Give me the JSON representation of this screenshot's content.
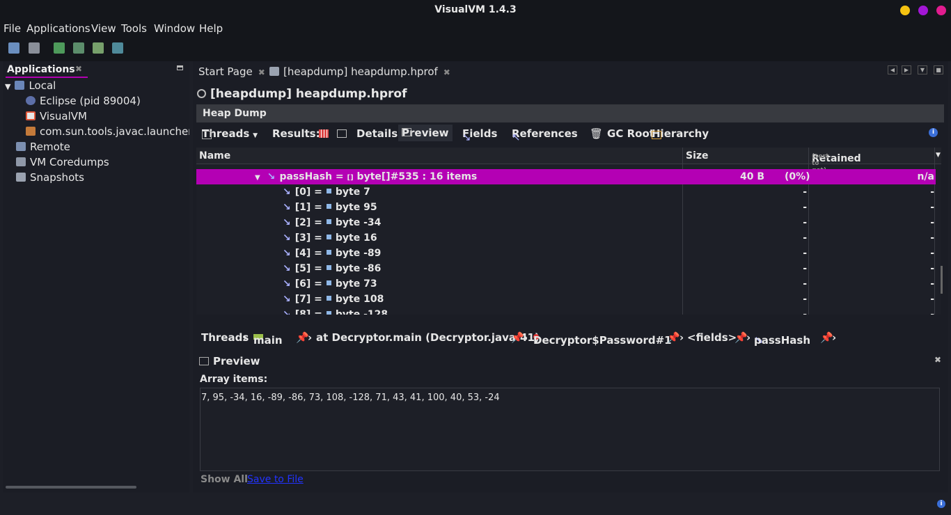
{
  "window": {
    "title": "VisualVM 1.4.3",
    "colors": {
      "yellow": "#f5c211",
      "purple": "#a316d6",
      "pink": "#e11c8f"
    }
  },
  "menu": [
    "File",
    "Applications",
    "View",
    "Tools",
    "Window",
    "Help"
  ],
  "left_panel": {
    "tab": "Applications",
    "tree": [
      {
        "label": "Local",
        "icon": "local-host-icon",
        "expanded": true
      },
      {
        "label": "Eclipse (pid 89004)",
        "icon": "eclipse-icon"
      },
      {
        "label": "VisualVM",
        "icon": "visualvm-icon"
      },
      {
        "label": "com.sun.tools.javac.launcher.M",
        "icon": "java-icon"
      },
      {
        "label": "Remote",
        "icon": "remote-icon"
      },
      {
        "label": "VM Coredumps",
        "icon": "coredump-icon"
      },
      {
        "label": "Snapshots",
        "icon": "snapshot-icon"
      }
    ]
  },
  "tabs": [
    {
      "label": "Start Page"
    },
    {
      "label": "[heapdump] heapdump.hprof"
    }
  ],
  "document": {
    "title": "[heapdump] heapdump.hprof",
    "section": "Heap Dump",
    "subbar": {
      "threads": "Threads",
      "results": "Results:",
      "details": "Details:",
      "preview": "Preview",
      "fields": "Fields",
      "references": "References",
      "gc_root": "GC Root",
      "hierarchy": "Hierarchy"
    },
    "table": {
      "columns": {
        "name": "Name",
        "size": "Size",
        "retained": "Retained",
        "retained_hint": "(sort to get)"
      },
      "rows": [
        {
          "name": "passHash",
          "value": "byte[]#535 : 16 items",
          "size": "40 B",
          "pct": "(0%)",
          "retained": "n/a",
          "selected": true
        },
        {
          "name": "[0]",
          "value": "byte 7",
          "size": "-",
          "retained": "-"
        },
        {
          "name": "[1]",
          "value": "byte 95",
          "size": "-",
          "retained": "-"
        },
        {
          "name": "[2]",
          "value": "byte -34",
          "size": "-",
          "retained": "-"
        },
        {
          "name": "[3]",
          "value": "byte 16",
          "size": "-",
          "retained": "-"
        },
        {
          "name": "[4]",
          "value": "byte -89",
          "size": "-",
          "retained": "-"
        },
        {
          "name": "[5]",
          "value": "byte -86",
          "size": "-",
          "retained": "-"
        },
        {
          "name": "[6]",
          "value": "byte 73",
          "size": "-",
          "retained": "-"
        },
        {
          "name": "[7]",
          "value": "byte 108",
          "size": "-",
          "retained": "-"
        },
        {
          "name": "[8]",
          "value": "byte -128",
          "size": "-",
          "retained": "-"
        }
      ]
    },
    "breadcrumb": [
      "Threads",
      "main",
      "at Decryptor.main (Decryptor.java:41)",
      "Decryptor$Password#1",
      "<fields>",
      "passHash"
    ],
    "preview": {
      "title": "Preview",
      "label": "Array items:",
      "content": "7, 95, -34, 16, -89, -86, 73, 108, -128, 71, 43, 41, 100, 40, 53, -24",
      "show_all": "Show All",
      "save": "Save to File"
    }
  }
}
